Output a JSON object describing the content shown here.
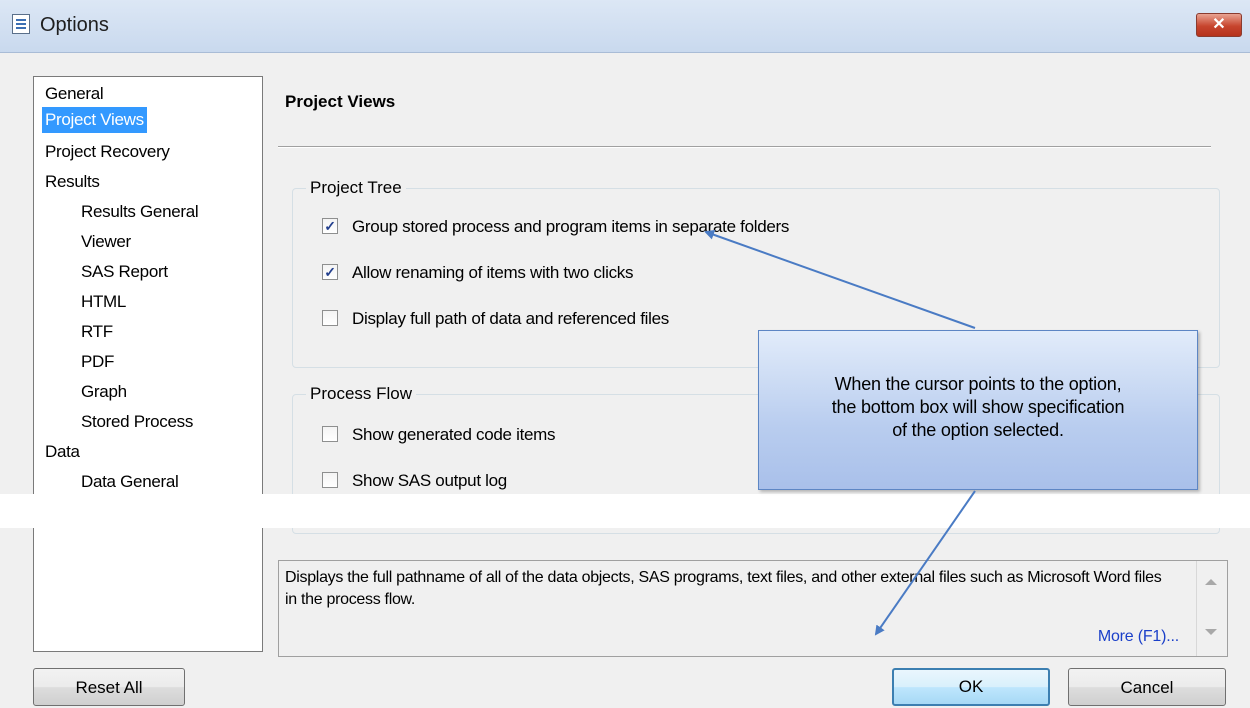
{
  "window": {
    "title": "Options",
    "close_label": "✕"
  },
  "nav": {
    "items": [
      {
        "label": "General",
        "selected": false
      },
      {
        "label": "Project Views",
        "selected": true
      },
      {
        "label": "Project Recovery",
        "selected": false
      },
      {
        "label": "Results",
        "selected": false
      },
      {
        "label": "Results General",
        "selected": false
      },
      {
        "label": "Viewer",
        "selected": false
      },
      {
        "label": "SAS Report",
        "selected": false
      },
      {
        "label": "HTML",
        "selected": false
      },
      {
        "label": "RTF",
        "selected": false
      },
      {
        "label": "PDF",
        "selected": false
      },
      {
        "label": "Graph",
        "selected": false
      },
      {
        "label": "Stored Process",
        "selected": false
      },
      {
        "label": "Data",
        "selected": false
      },
      {
        "label": "Data General",
        "selected": false
      }
    ]
  },
  "main": {
    "heading": "Project Views",
    "project_tree": {
      "title": "Project Tree",
      "options": [
        {
          "label": "Group stored process and program items in separate folders",
          "checked": true
        },
        {
          "label": "Allow renaming of items with two clicks",
          "checked": true
        },
        {
          "label": "Display full path of data and referenced files",
          "checked": false
        }
      ]
    },
    "process_flow": {
      "title": "Process Flow",
      "options": [
        {
          "label": "Show generated code items",
          "checked": false
        },
        {
          "label": "Show SAS output log",
          "checked": false
        }
      ]
    },
    "description": {
      "text": "Displays the full pathname of all of the data objects, SAS programs, text files, and other external files such as Microsoft Word files in the process flow.",
      "more_link": "More (F1)..."
    }
  },
  "buttons": {
    "reset_all": "Reset All",
    "ok": "OK",
    "cancel": "Cancel"
  },
  "callout": {
    "lines": [
      "When the cursor points to the option,",
      "the bottom  box will show specification",
      "of the option selected."
    ],
    "colors": {
      "fill": "#b9cdef",
      "border": "#5d86c4",
      "arrow": "#4a7bc4"
    }
  },
  "colors": {
    "selection": "#3399ff",
    "link": "#1a3fc9",
    "close_button": "#c7452e"
  }
}
